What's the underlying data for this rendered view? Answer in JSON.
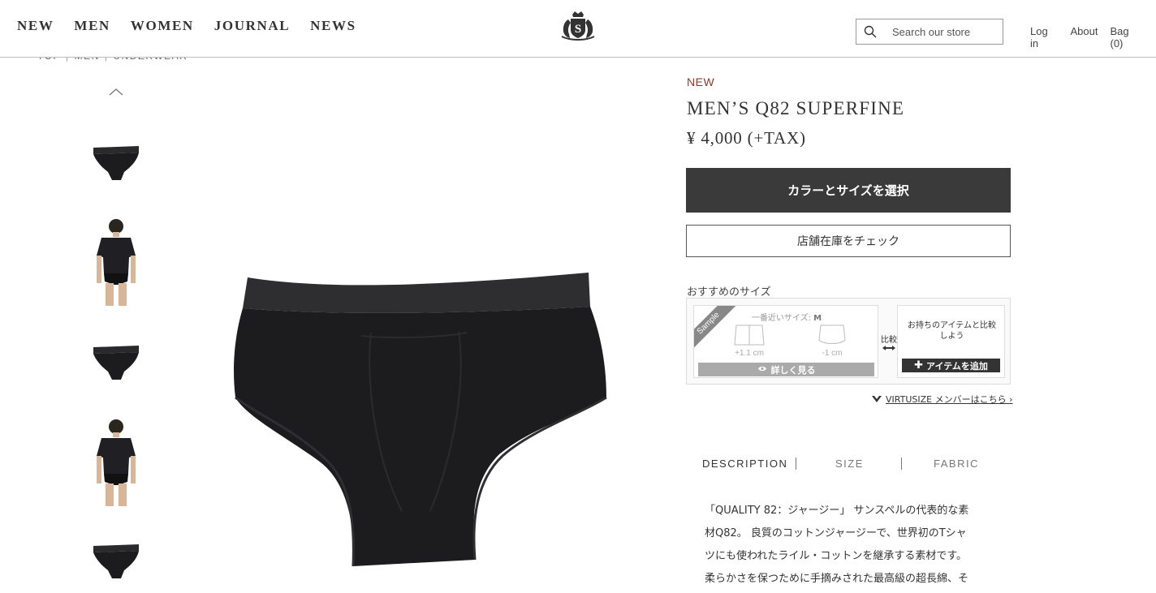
{
  "header": {
    "nav": [
      "NEW",
      "MEN",
      "WOMEN",
      "JOURNAL",
      "NEWS"
    ],
    "logo_letter": "S",
    "search_placeholder": "Search our store",
    "links": {
      "login": "Log in",
      "about": "About",
      "bag": "Bag (0)"
    }
  },
  "breadcrumb": [
    "TOP",
    "MEN",
    "UNDERWEAR"
  ],
  "gallery": {
    "thumbnails": [
      "briefs-front",
      "model-front",
      "briefs-front",
      "model-front",
      "briefs-front"
    ]
  },
  "product": {
    "badge": "NEW",
    "title": "MEN’S Q82 SUPERFINE",
    "price": "¥ 4,000 (+TAX)",
    "select_button": "カラーとサイズを選択",
    "stock_button": "店舗在庫をチェック"
  },
  "virtusize": {
    "label": "おすすめのサイズ",
    "sample": "Sample",
    "closest_prefix": "一番近いサイズ: ",
    "closest_size": "M",
    "diff_left": "+1.1 cm",
    "diff_right": "-1 cm",
    "detail_button": "詳しく見る",
    "compare": "比較",
    "own_item": "お持ちのアイテムと比較しよう",
    "add_button": "アイテムを追加",
    "member_link": "VIRTUSIZE メンバーはこちら ›"
  },
  "tabs": [
    "DESCRIPTION",
    "SIZE",
    "FABRIC"
  ],
  "description": [
    "「QUALITY 82：ジャージー」 サンスペルの代表的な素",
    "材Q82。 良質のコットンジャージーで、世界初のTシャ",
    "ツにも使われたライル・コットンを継承する素材です。",
    "柔らかさを保つために手摘みされた最高級の超長綿、そ"
  ],
  "colors": {
    "accent_new": "#8c3a2c",
    "button_dark": "#3a3a3a",
    "product": "#1c1c1e"
  }
}
